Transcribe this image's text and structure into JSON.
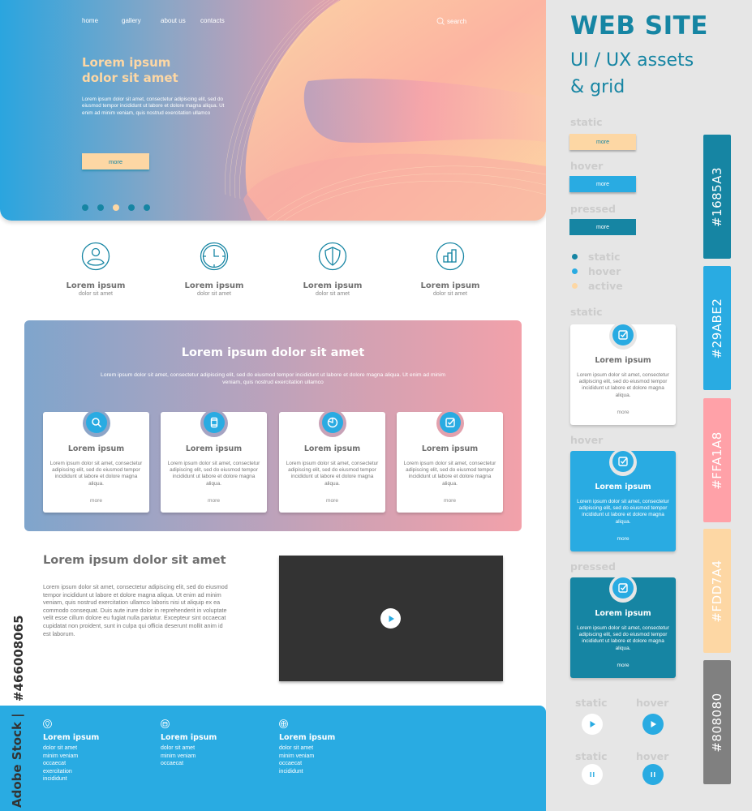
{
  "hero": {
    "nav": [
      "home",
      "gallery",
      "about us",
      "contacts"
    ],
    "search_label": "search",
    "title_line1": "Lorem ipsum",
    "title_line2": "dolor sit amet",
    "text": "Lorem ipsum dolor sit amet, consectetur adipiscing elit, sed do eiusmod tempor incididunt ut labore et dolore magna aliqua. Ut enim ad minim veniam, quis nostrud exercitation ullamco",
    "button_label": "more",
    "slider_dots": 5,
    "active_dot": 3
  },
  "features": [
    {
      "icon": "user-icon",
      "title": "Lorem ipsum",
      "subtitle": "dolor sit amet"
    },
    {
      "icon": "clock-icon",
      "title": "Lorem ipsum",
      "subtitle": "dolor sit amet"
    },
    {
      "icon": "shield-icon",
      "title": "Lorem ipsum",
      "subtitle": "dolor sit amet"
    },
    {
      "icon": "bar-chart-icon",
      "title": "Lorem ipsum",
      "subtitle": "dolor sit amet"
    }
  ],
  "services": {
    "title": "Lorem ipsum dolor sit amet",
    "description": "Lorem ipsum dolor sit amet, consectetur adipiscing elit, sed do eiusmod tempor incididunt ut labore et dolore magna aliqua. Ut enim ad minim veniam, quis nostrud exercitation ullamco",
    "cards": [
      {
        "icon": "search-icon",
        "title": "Lorem ipsum",
        "text": "Lorem ipsum dolor sit amet, consectetur adipiscing elit, sed do eiusmod tempor incididunt ut labore et dolore magna aliqua.",
        "link": "more"
      },
      {
        "icon": "mobile-icon",
        "title": "Lorem ipsum",
        "text": "Lorem ipsum dolor sit amet, consectetur adipiscing elit, sed do eiusmod tempor incididunt ut labore et dolore magna aliqua.",
        "link": "more"
      },
      {
        "icon": "pie-chart-icon",
        "title": "Lorem ipsum",
        "text": "Lorem ipsum dolor sit amet, consectetur adipiscing elit, sed do eiusmod tempor incididunt ut labore et dolore magna aliqua.",
        "link": "more"
      },
      {
        "icon": "checkbox-icon",
        "title": "Lorem ipsum",
        "text": "Lorem ipsum dolor sit amet, consectetur adipiscing elit, sed do eiusmod tempor incididunt ut labore et dolore magna aliqua.",
        "link": "more"
      }
    ]
  },
  "about": {
    "title": "Lorem ipsum dolor sit amet",
    "text": "Lorem ipsum dolor sit amet, consectetur adipiscing elit, sed do eiusmod tempor incididunt ut labore et dolore magna aliqua. Ut enim ad minim veniam, quis nostrud exercitation ullamco laboris nisi ut aliquip ex ea commodo consequat. Duis aute irure dolor in reprehenderit in voluptate velit esse cillum dolore eu fugiat nulla pariatur. Excepteur sint occaecat cupidatat non proident, sunt in culpa qui officia deserunt mollit anim id est laborum."
  },
  "footer": {
    "columns": [
      {
        "icon": "location-pin-icon",
        "title": "Lorem ipsum",
        "links": [
          "dolor sit amet",
          "minim veniam",
          "occaecat",
          "exercitation",
          "incididunt"
        ]
      },
      {
        "icon": "phone-icon",
        "title": "Lorem ipsum",
        "links": [
          "dolor sit amet",
          "minim veniam",
          "occaecat"
        ]
      },
      {
        "icon": "globe-icon",
        "title": "Lorem ipsum",
        "links": [
          "dolor sit amet",
          "minim veniam",
          "occaecat",
          "incididunt"
        ]
      }
    ]
  },
  "watermark": {
    "id": "#466008065",
    "stock": "Adobe Stock |"
  },
  "sidebar": {
    "title": "WEB SITE",
    "subtitle_line1": "UI / UX assets",
    "subtitle_line2": "& grid",
    "button_states": [
      {
        "state": "static",
        "label": "more",
        "bg": "#FDD7A4",
        "fg": "#1685A3"
      },
      {
        "state": "hover",
        "label": "more",
        "bg": "#29ABE2",
        "fg": "#FFFFFF"
      },
      {
        "state": "pressed",
        "label": "more",
        "bg": "#1685A3",
        "fg": "#FFFFFF"
      }
    ],
    "legend": [
      {
        "label": "static",
        "color": "#1685A3"
      },
      {
        "label": "hover",
        "color": "#29ABE2"
      },
      {
        "label": "active",
        "color": "#FDD7A4"
      }
    ],
    "card_states": [
      {
        "state": "static",
        "title": "Lorem ipsum",
        "text": "Lorem ipsum dolor sit amet, consectetur adipiscing elit, sed do eiusmod tempor incididunt ut labore et dolore magna aliqua.",
        "link": "more",
        "bg": "#FFFFFF",
        "fg": "#6F6F6F"
      },
      {
        "state": "hover",
        "title": "Lorem ipsum",
        "text": "Lorem ipsum dolor sit amet, consectetur adipiscing elit, sed do eiusmod tempor incididunt ut labore et dolore magna aliqua.",
        "link": "more",
        "bg": "#29ABE2",
        "fg": "#FFFFFF"
      },
      {
        "state": "pressed",
        "title": "Lorem ipsum",
        "text": "Lorem ipsum dolor sit amet, consectetur adipiscing elit, sed do eiusmod tempor incididunt ut labore et dolore magna aliqua.",
        "link": "more",
        "bg": "#1685A3",
        "fg": "#FFFFFF"
      }
    ],
    "player_controls": [
      {
        "state": "static",
        "type": "play"
      },
      {
        "state": "hover",
        "type": "play"
      },
      {
        "state": "static",
        "type": "pause"
      },
      {
        "state": "hover",
        "type": "pause"
      }
    ],
    "palette": [
      "#1685A3",
      "#29ABE2",
      "#FFA1A8",
      "#FDD7A4",
      "#808080"
    ]
  }
}
